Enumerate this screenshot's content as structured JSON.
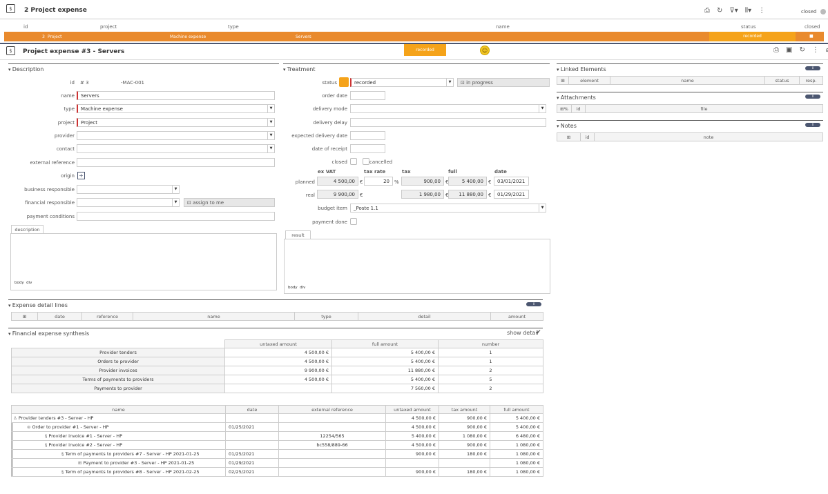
{
  "list_header": {
    "title": "2 Project expense",
    "closed_label": "closed",
    "columns": [
      "id",
      "project",
      "type",
      "name",
      "status",
      "closed"
    ],
    "row": {
      "id": "3",
      "project": "Project",
      "type": "Machine expense",
      "name": "Servers",
      "status": "recorded",
      "closed": "■"
    }
  },
  "detail_header": {
    "title": "Project expense  #3  - Servers",
    "status": "recorded",
    "status_color": "#f5a31a"
  },
  "description": {
    "section_label": "Description",
    "id_label": "id",
    "id_value": "# 3",
    "reference": "-MAC-001",
    "name_label": "name",
    "name_value": "Servers",
    "type_label": "type",
    "type_value": "Machine expense",
    "project_label": "project",
    "project_value": "Project",
    "provider_label": "provider",
    "contact_label": "contact",
    "external_reference_label": "external reference",
    "origin_label": "origin",
    "business_responsible_label": "business responsible",
    "financial_responsible_label": "financial responsible",
    "assign_label": "assign to me",
    "payment_conditions_label": "payment conditions",
    "desc_tab": "description",
    "editor_footer": "body  div"
  },
  "treatment": {
    "section_label": "Treatment",
    "status_label": "status",
    "status_value": "recorded",
    "in_progress_label": "in progress",
    "order_date_label": "order date",
    "delivery_mode_label": "delivery mode",
    "delivery_delay_label": "delivery delay",
    "expected_delivery_label": "expected delivery date",
    "date_receipt_label": "date of receipt",
    "closed_label": "closed",
    "cancelled_label": "cancelled",
    "col_exvat": "ex VAT",
    "col_taxrate": "tax rate",
    "col_tax": "tax",
    "col_full": "full",
    "col_date": "date",
    "planned_label": "planned",
    "planned_exvat": "4 500,00",
    "planned_rate": "20",
    "planned_tax": "900,00",
    "planned_full": "5 400,00",
    "planned_date": "03/01/2021",
    "real_label": "real",
    "real_exvat": "9 900,00",
    "real_tax": "1 980,00",
    "real_full": "11 880,00",
    "real_date": "01/29/2021",
    "euro": "€",
    "percent": "%",
    "budget_item_label": "budget item",
    "budget_item_value": "_Poste 1.1",
    "payment_done_label": "payment done",
    "result_tab": "result",
    "editor_footer": "body  div"
  },
  "linked": {
    "section_label": "Linked Elements",
    "count": "0",
    "columns": [
      "element",
      "name",
      "status",
      "resp."
    ]
  },
  "attachments": {
    "section_label": "Attachments",
    "count": "0",
    "columns": [
      "id",
      "file"
    ]
  },
  "notes": {
    "section_label": "Notes",
    "count": "0",
    "columns": [
      "id",
      "note"
    ]
  },
  "expense_lines": {
    "section_label": "Expense detail lines",
    "count": "0",
    "columns": [
      "date",
      "reference",
      "name",
      "type",
      "detail",
      "amount"
    ]
  },
  "synthesis": {
    "section_label": "Financial expense synthesis",
    "show_detail": "show detail",
    "columns": [
      "untaxed amount",
      "full amount",
      "number"
    ],
    "rows": [
      {
        "label": "Provider tenders",
        "untaxed": "4 500,00 €",
        "full": "5 400,00 €",
        "number": "1"
      },
      {
        "label": "Orders to provider",
        "untaxed": "4 500,00 €",
        "full": "5 400,00 €",
        "number": "1"
      },
      {
        "label": "Provider invoices",
        "untaxed": "9 900,00 €",
        "full": "11 880,00 €",
        "number": "2"
      },
      {
        "label": "Terms of payments to providers",
        "untaxed": "4 500,00 €",
        "full": "5 400,00 €",
        "number": "5"
      },
      {
        "label": "Payments to provider",
        "untaxed": "",
        "full": "7 560,00 €",
        "number": "2"
      }
    ]
  },
  "detail_table": {
    "columns": [
      "name",
      "date",
      "external reference",
      "untaxed amount",
      "tax amount",
      "full amount"
    ],
    "rows": [
      {
        "name": "Provider tenders #3 - Server - HP",
        "date": "",
        "ref": "",
        "untaxed": "4 500,00 €",
        "tax": "900,00 €",
        "full": "5 400,00 €"
      },
      {
        "name": "Order to provider #1 - Server - HP",
        "date": "01/25/2021",
        "ref": "",
        "untaxed": "4 500,00 €",
        "tax": "900,00 €",
        "full": "5 400,00 €"
      },
      {
        "name": "Provider invoice #1 - Server - HP",
        "date": "",
        "ref": "12254/565",
        "untaxed": "5 400,00 €",
        "tax": "1 080,00 €",
        "full": "6 480,00 €"
      },
      {
        "name": "Provider invoice #2 - Server - HP",
        "date": "",
        "ref": "bc558/889-66",
        "untaxed": "4 500,00 €",
        "tax": "900,00 €",
        "full": "1 080,00 €"
      },
      {
        "name": "Term of payments to providers #7 - Server - HP 2021-01-25",
        "date": "01/25/2021",
        "ref": "",
        "untaxed": "900,00 €",
        "tax": "180,00 €",
        "full": "1 080,00 €"
      },
      {
        "name": "Payment to provider #3 - Server - HP 2021-01-25",
        "date": "01/29/2021",
        "ref": "",
        "untaxed": "",
        "tax": "",
        "full": "1 080,00 €"
      },
      {
        "name": "Term of payments to providers #8 - Server - HP 2021-02-25",
        "date": "02/25/2021",
        "ref": "",
        "untaxed": "900,00 €",
        "tax": "180,00 €",
        "full": "1 080,00 €"
      }
    ]
  }
}
